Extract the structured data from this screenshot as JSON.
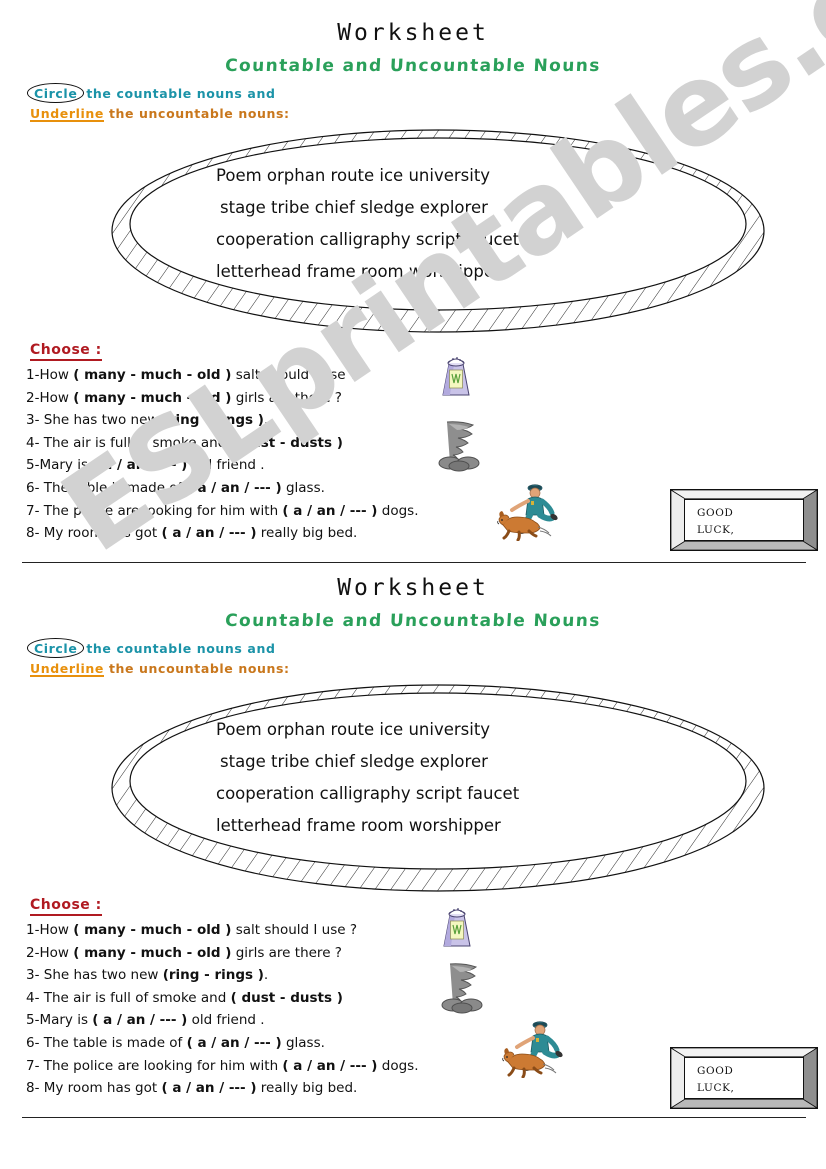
{
  "watermark": {
    "text": "ESLprintables.com"
  },
  "worksheet": {
    "title": "Worksheet",
    "subtitle": "Countable and Uncountable Nouns",
    "instruction": {
      "circle_word": "Circle",
      "circle_rest": "the countable nouns and",
      "underline_word": "Underline",
      "underline_rest": "the uncountable nouns:"
    },
    "oval_words": {
      "line1": "Poem     orphan   route    ice  university",
      "line2": "stage  tribe   chief   sledge   explorer",
      "line3": "cooperation  calligraphy  script faucet",
      "line4": "letterhead  frame  room   worshipper",
      "all": [
        "Poem",
        "orphan",
        "route",
        "ice",
        "university",
        "stage",
        "tribe",
        "chief",
        "sledge",
        "explorer",
        "cooperation",
        "calligraphy",
        "script",
        "faucet",
        "letterhead",
        "frame",
        "room",
        "worshipper"
      ]
    },
    "choose": {
      "heading": "Choose :",
      "questions": [
        "1-How  ( many  -  much  - old  ) salt  should  I  use ?",
        "2-How  ( many  -  much  - old  ) girls  are  there ?",
        "3- She  has  two  new  (ring  -  rings ).",
        "4- The  air  is  full  of  smoke  and  ( dust  -  dusts  )",
        "5-Mary  is  ( a  /  an  / --- ) old  friend .",
        "6- The table is made of  ( a  /  an  / ---  )  glass.",
        "7- The  police are looking for him with ( a  /  an  / ---  ) dogs.",
        "8- My room has got ( a  /  an  / ---  ) really  big   bed."
      ],
      "questions_rich": [
        {
          "pre": "1-How ",
          "bold": " ( many  -  much  - old  )",
          "post": " salt  should  I  use ?"
        },
        {
          "pre": "2-How ",
          "bold": " ( many  -  much  - old  )",
          "post": " girls  are  there ?"
        },
        {
          "pre": "3- She  has  two  new ",
          "bold": " (ring  -  rings )",
          "post": "."
        },
        {
          "pre": "4- The  air  is  full  of  smoke  and ",
          "bold": " ( dust  -  dusts  )",
          "post": ""
        },
        {
          "pre": "5-Mary  is ",
          "bold": " ( a  /  an  / --- )",
          "post": " old  friend ."
        },
        {
          "pre": "6- The table is made of ",
          "bold": " ( a  /  an  / ---  )",
          "post": "  glass."
        },
        {
          "pre": "7- The  police are looking for him with ",
          "bold": " ( a  /  an  / ---  )",
          "post": " dogs."
        },
        {
          "pre": "8- My room has got ",
          "bold": " ( a  /  an  / ---  )",
          "post": " really  big   bed."
        }
      ]
    },
    "plaque": {
      "line1": "GOOD",
      "line2": "LUCK,"
    }
  },
  "clipart": {
    "salt_shaker": "salt-shaker-clipart",
    "dust_tornado": "dust-tornado-clipart",
    "police_dog": "police-officer-with-dog-clipart"
  },
  "colors": {
    "title": "#111111",
    "subtitle_green": "#2aa05a",
    "circle_teal": "#1b93a8",
    "underline_orange": "#e8900c",
    "choose_red": "#b01a21",
    "watermark_grey": "#d2d2d2"
  }
}
